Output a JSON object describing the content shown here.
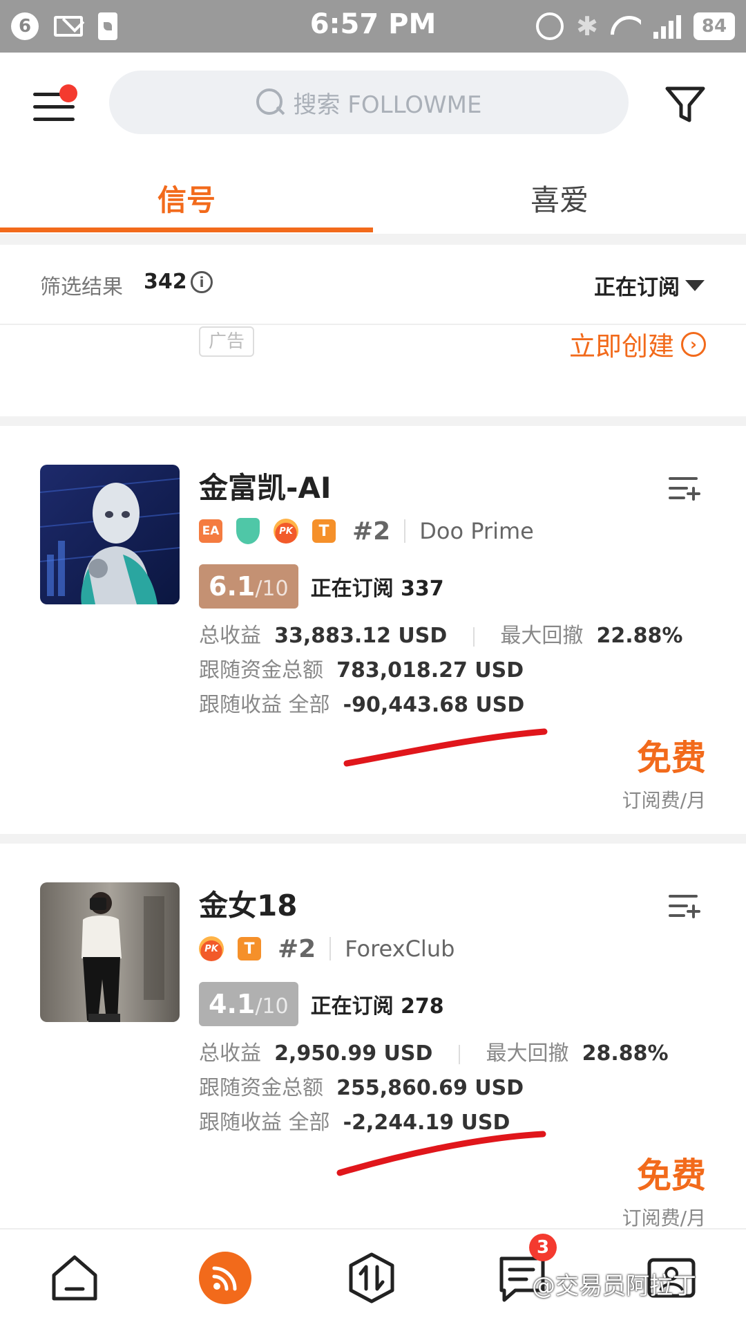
{
  "status_bar": {
    "notification_count": "6",
    "time": "6:57 PM",
    "battery": "84"
  },
  "header": {
    "search_placeholder": "搜索 FOLLOWME"
  },
  "tabs": [
    {
      "label": "信号",
      "active": true
    },
    {
      "label": "喜爱",
      "active": false
    }
  ],
  "filter_bar": {
    "result_label": "筛选结果",
    "result_count": "342",
    "sort_label": "正在订阅"
  },
  "ad": {
    "tag": "广告",
    "create_label": "立即创建"
  },
  "signals": [
    {
      "name": "金富凯-AI",
      "badges": [
        "EA",
        "shield-icon",
        "PK",
        "T"
      ],
      "rank": "#2",
      "broker": "Doo Prime",
      "score": "6.1",
      "score_max": "/10",
      "score_color": "#c49173",
      "subscribing": "正在订阅 337",
      "total_profit_label": "总收益",
      "total_profit": "33,883.12 USD",
      "max_drawdown_label": "最大回撤",
      "max_drawdown": "22.88%",
      "follow_funds_label": "跟随资金总额",
      "follow_funds": "783,018.27 USD",
      "follow_profit_label": "跟随收益 全部",
      "follow_profit": "-90,443.68 USD",
      "price": "免费",
      "price_unit": "订阅费/月"
    },
    {
      "name": "金女18",
      "badges": [
        "PK",
        "T"
      ],
      "rank": "#2",
      "broker": "ForexClub",
      "score": "4.1",
      "score_max": "/10",
      "score_color": "#b0b0b0",
      "subscribing": "正在订阅 278",
      "total_profit_label": "总收益",
      "total_profit": "2,950.99 USD",
      "max_drawdown_label": "最大回撤",
      "max_drawdown": "28.88%",
      "follow_funds_label": "跟随资金总额",
      "follow_funds": "255,860.69 USD",
      "follow_profit_label": "跟随收益 全部",
      "follow_profit": "-2,244.19 USD",
      "price": "免费",
      "price_unit": "订阅费/月"
    }
  ],
  "bottom_nav": {
    "items": [
      "home-icon",
      "rss-icon",
      "exchange-icon",
      "message-icon",
      "profile-icon"
    ],
    "message_badge": "3"
  },
  "watermark": "@交易员阿拉丁",
  "colors": {
    "accent": "#f26a1b",
    "annotation": "#e0161b"
  }
}
